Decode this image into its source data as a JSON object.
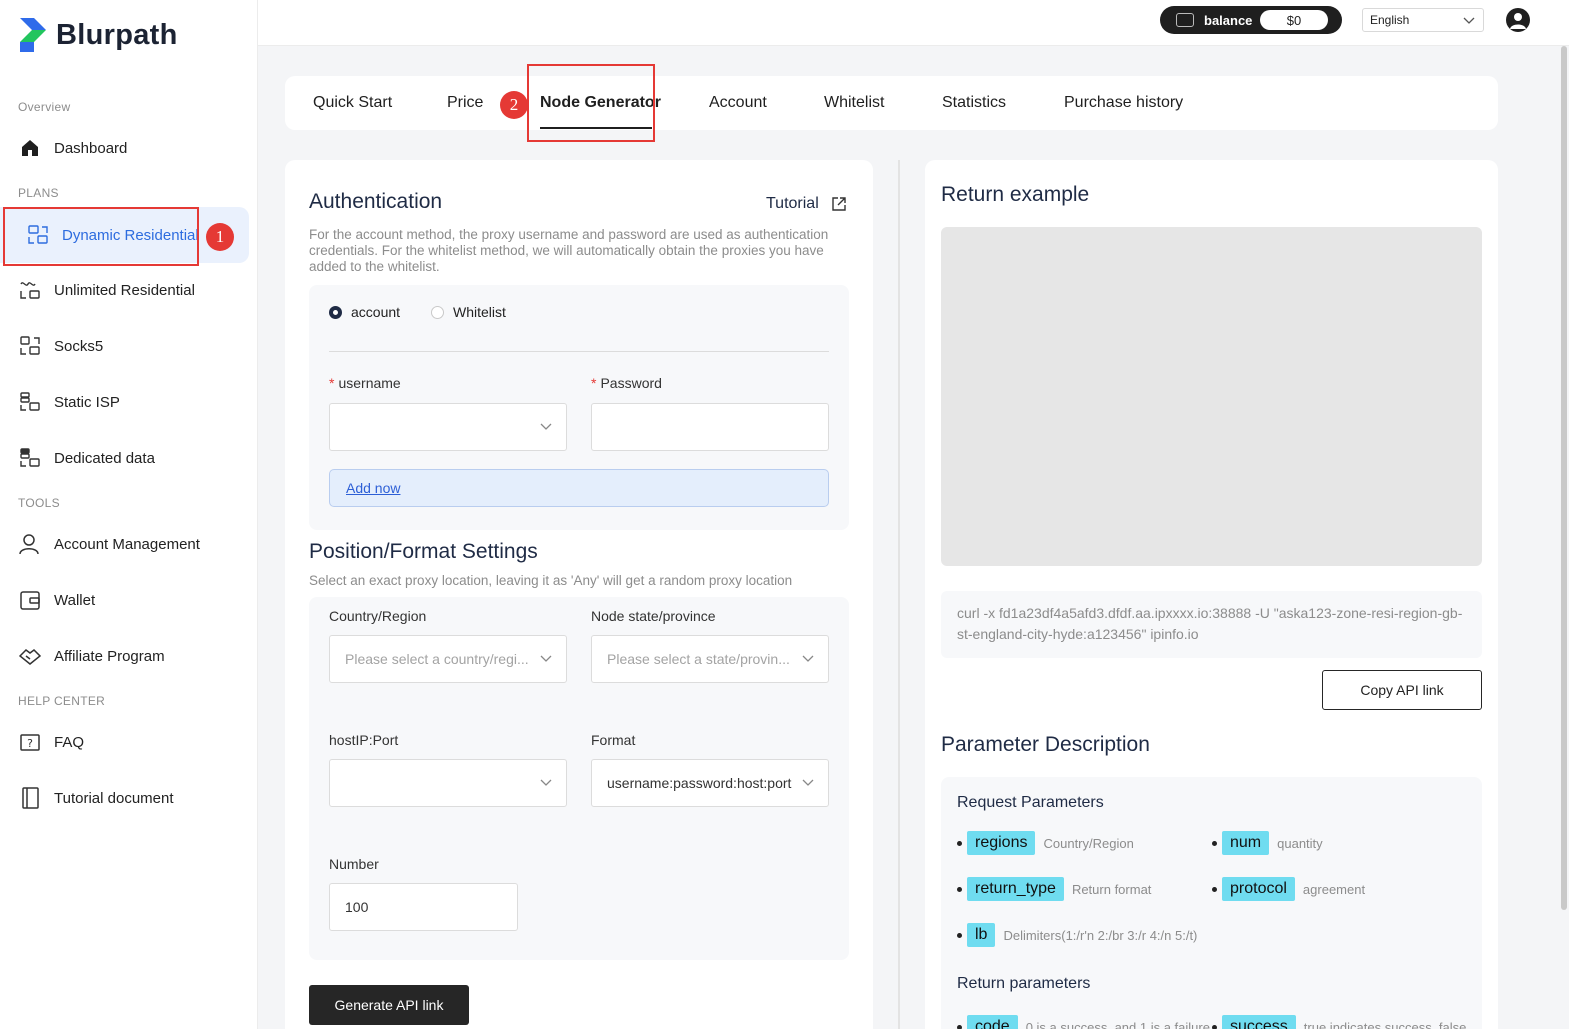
{
  "brand": {
    "name": "Blurpath"
  },
  "sidebar": {
    "sections": {
      "overview": "Overview",
      "plans": "PLANS",
      "tools": "TOOLS",
      "help": "HELP CENTER"
    },
    "items": [
      {
        "label": "Dashboard",
        "icon": "home-icon"
      },
      {
        "label": "Dynamic Residential",
        "icon": "proxy-network-icon",
        "active": true
      },
      {
        "label": "Unlimited Residential",
        "icon": "infinite-network-icon"
      },
      {
        "label": "Socks5",
        "icon": "socks-network-icon"
      },
      {
        "label": "Static ISP",
        "icon": "server-network-icon"
      },
      {
        "label": "Dedicated data",
        "icon": "dedicated-network-icon"
      },
      {
        "label": "Account Management",
        "icon": "user-icon"
      },
      {
        "label": "Wallet",
        "icon": "wallet-icon"
      },
      {
        "label": "Affiliate Program",
        "icon": "handshake-icon"
      },
      {
        "label": "FAQ",
        "icon": "faq-icon"
      },
      {
        "label": "Tutorial document",
        "icon": "document-icon"
      }
    ]
  },
  "annotations": {
    "one": "1",
    "two": "2"
  },
  "header": {
    "balance_label": "balance",
    "balance_value": "$0",
    "language": "English"
  },
  "tabs": [
    {
      "label": "Quick Start"
    },
    {
      "label": "Price"
    },
    {
      "label": "Node Generator",
      "active": true
    },
    {
      "label": "Account"
    },
    {
      "label": "Whitelist"
    },
    {
      "label": "Statistics"
    },
    {
      "label": "Purchase history"
    }
  ],
  "auth": {
    "title": "Authentication",
    "tutorial": "Tutorial",
    "description": "For the account method, the proxy username and password are used as authentication credentials. For the whitelist method, we will automatically obtain the proxies you have added to the whitelist.",
    "methods": [
      {
        "label": "account",
        "selected": true
      },
      {
        "label": "Whitelist",
        "selected": false
      }
    ],
    "username_label": "username",
    "password_label": "Password",
    "required_mark": "*",
    "add_now": "Add now"
  },
  "position": {
    "title": "Position/Format Settings",
    "description": "Select an exact proxy location, leaving it as 'Any' will get a random proxy location",
    "country_label": "Country/Region",
    "country_placeholder": "Please select a country/regi...",
    "state_label": "Node state/province",
    "state_placeholder": "Please select a state/provin...",
    "host_label": "hostIP:Port",
    "format_label": "Format",
    "format_value": "username:password:host:port",
    "number_label": "Number",
    "number_value": "100",
    "generate_button": "Generate API link"
  },
  "return_example": {
    "title": "Return example",
    "curl": "curl -x fd1a23df4a5afd3.dfdf.aa.ipxxxx.io:38888 -U \"aska123-zone-resi-region-gb-st-england-city-hyde:a123456\" ipinfo.io",
    "copy_button": "Copy API link"
  },
  "params": {
    "title": "Parameter Description",
    "request_title": "Request Parameters",
    "request": [
      {
        "name": "regions",
        "desc": "Country/Region"
      },
      {
        "name": "num",
        "desc": "quantity"
      },
      {
        "name": "return_type",
        "desc": "Return format"
      },
      {
        "name": "protocol",
        "desc": "agreement"
      },
      {
        "name": "lb",
        "desc": "Delimiters(1:/r'n 2:/br 3:/r 4:/n 5:/t)"
      }
    ],
    "return_title": "Return parameters",
    "return": [
      {
        "name": "code",
        "desc": "0 is a success, and 1 is a failure"
      },
      {
        "name": "success",
        "desc": "true indicates success, false"
      }
    ]
  },
  "colors": {
    "accent": "#2d6cdf",
    "annotation": "#e53935",
    "tag": "#6fdcf0"
  }
}
